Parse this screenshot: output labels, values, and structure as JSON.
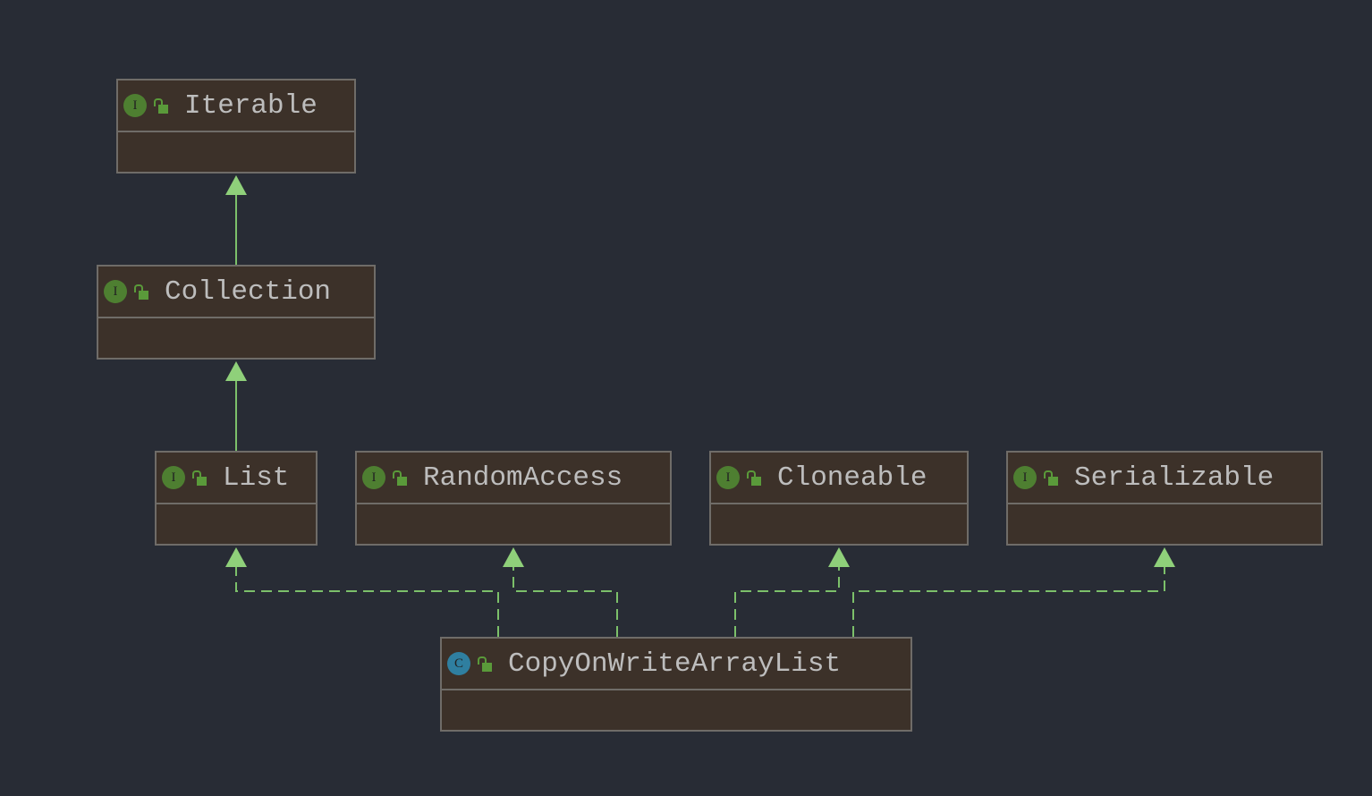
{
  "colors": {
    "background": "#282c35",
    "node_fill": "#3c3129",
    "node_border": "#6f6c68",
    "edge": "#7cc06a",
    "interface_badge": "#4e7f31",
    "class_badge": "#2f7fa0"
  },
  "nodes": {
    "iterable": {
      "name": "Iterable",
      "kind": "interface",
      "badge": "I"
    },
    "collection": {
      "name": "Collection",
      "kind": "interface",
      "badge": "I"
    },
    "list": {
      "name": "List",
      "kind": "interface",
      "badge": "I"
    },
    "random_access": {
      "name": "RandomAccess",
      "kind": "interface",
      "badge": "I"
    },
    "cloneable": {
      "name": "Cloneable",
      "kind": "interface",
      "badge": "I"
    },
    "serializable": {
      "name": "Serializable",
      "kind": "interface",
      "badge": "I"
    },
    "cowal": {
      "name": "CopyOnWriteArrayList",
      "kind": "class",
      "badge": "C"
    }
  },
  "edges": [
    {
      "from": "Collection",
      "to": "Iterable",
      "type": "extends"
    },
    {
      "from": "List",
      "to": "Collection",
      "type": "extends"
    },
    {
      "from": "CopyOnWriteArrayList",
      "to": "List",
      "type": "implements"
    },
    {
      "from": "CopyOnWriteArrayList",
      "to": "RandomAccess",
      "type": "implements"
    },
    {
      "from": "CopyOnWriteArrayList",
      "to": "Cloneable",
      "type": "implements"
    },
    {
      "from": "CopyOnWriteArrayList",
      "to": "Serializable",
      "type": "implements"
    }
  ]
}
